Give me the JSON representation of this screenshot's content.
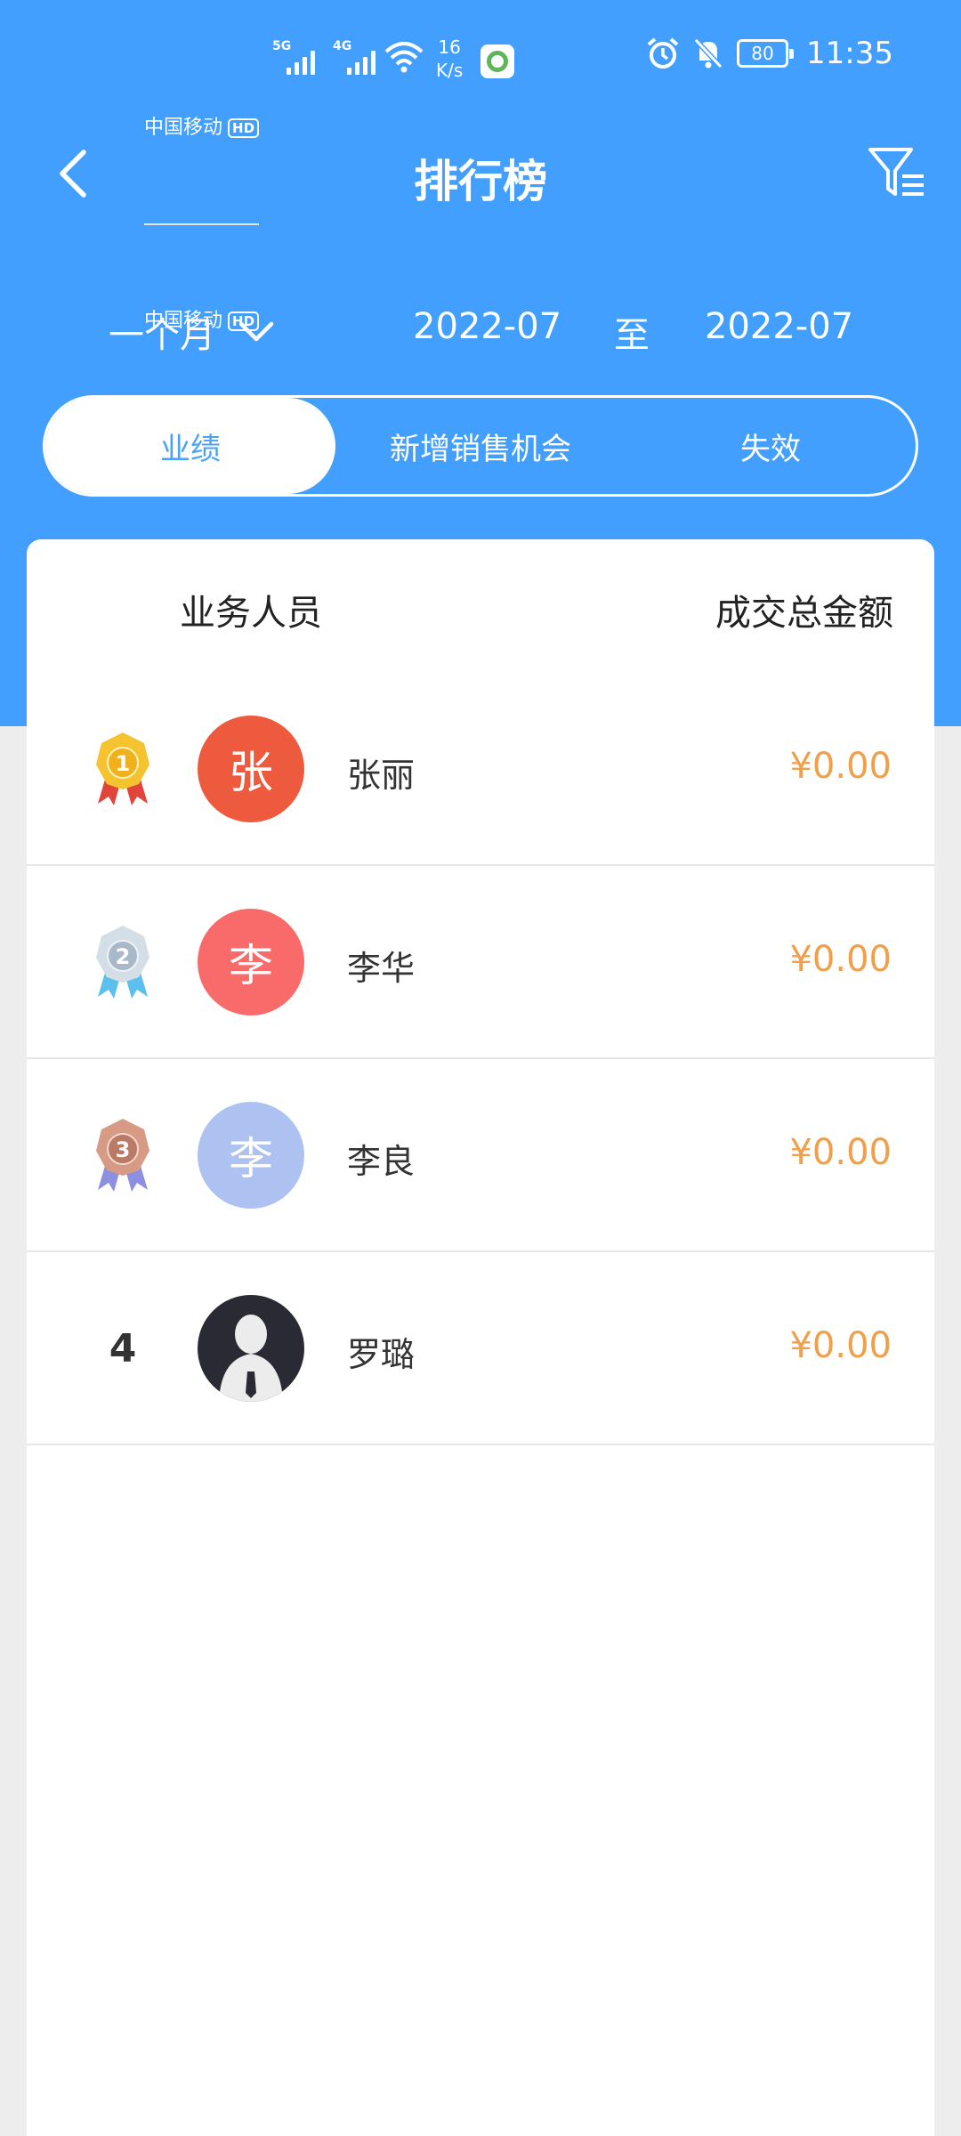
{
  "status_bar": {
    "carrier1": "中国移动",
    "carrier2": "中国移动",
    "hd": "HD",
    "sig1_tag": "5G",
    "sig2_tag": "4G",
    "speed_value": "16",
    "speed_unit": "K/s",
    "battery": "80",
    "time": "11:35"
  },
  "nav": {
    "title": "排行榜"
  },
  "filter": {
    "period": "一个月",
    "date_from": "2022-07",
    "to_label": "至",
    "date_to": "2022-07"
  },
  "tabs": [
    {
      "label": "业绩",
      "active": true
    },
    {
      "label": "新增销售机会",
      "active": false
    },
    {
      "label": "失效",
      "active": false
    }
  ],
  "list": {
    "header_person": "业务人员",
    "header_amount": "成交总金额",
    "rows": [
      {
        "rank": "1",
        "avatar_char": "张",
        "avatar_color": "#ed5a3d",
        "name": "张丽",
        "amount": "¥0.00"
      },
      {
        "rank": "2",
        "avatar_char": "李",
        "avatar_color": "#f96b6b",
        "name": "李华",
        "amount": "¥0.00"
      },
      {
        "rank": "3",
        "avatar_char": "李",
        "avatar_color": "#aec2f1",
        "name": "李良",
        "amount": "¥0.00"
      },
      {
        "rank": "4",
        "avatar_char": "",
        "avatar_color": "#2a2a35",
        "name": "罗璐",
        "amount": "¥0.00"
      }
    ]
  },
  "colors": {
    "primary": "#429ffd",
    "amount": "#f0a04b",
    "gold": "#f5c330",
    "silver": "#b8c7d6",
    "bronze": "#c88d78"
  }
}
